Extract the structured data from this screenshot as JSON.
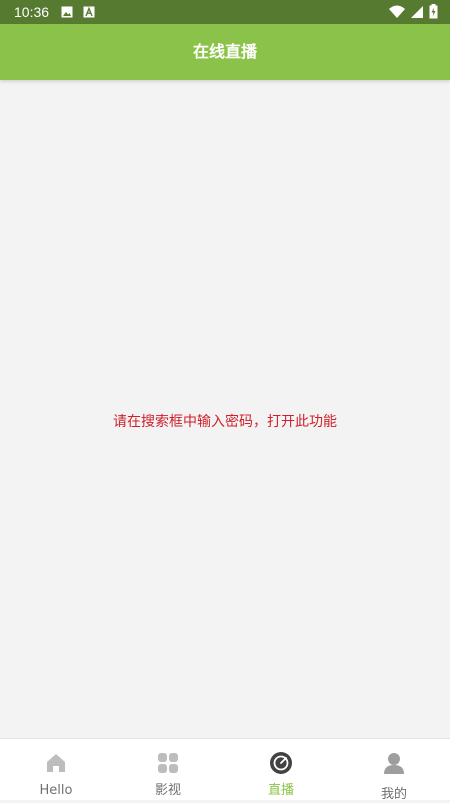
{
  "status_bar": {
    "time": "10:36",
    "left_icons": [
      "image-icon",
      "a-box-icon"
    ],
    "right_icons": [
      "wifi-icon",
      "signal-icon",
      "battery-icon"
    ]
  },
  "app_bar": {
    "title": "在线直播",
    "color": "#8bc34a"
  },
  "content": {
    "notice": "请在搜索框中输入密码，打开此功能",
    "notice_color": "#d0202a"
  },
  "bottom_nav": {
    "active_index": 2,
    "items": [
      {
        "label": "Hello",
        "icon": "home-icon"
      },
      {
        "label": "影视",
        "icon": "grid-icon"
      },
      {
        "label": "直播",
        "icon": "live-icon"
      },
      {
        "label": "我的",
        "icon": "person-icon"
      }
    ]
  }
}
